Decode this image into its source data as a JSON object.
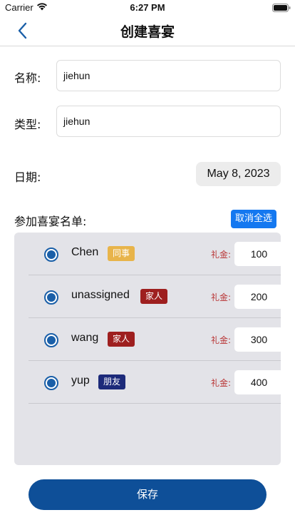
{
  "status_bar": {
    "carrier": "Carrier",
    "time": "6:27 PM"
  },
  "nav": {
    "title": "创建喜宴"
  },
  "form": {
    "name_label": "名称:",
    "name_value": "jiehun",
    "type_label": "类型:",
    "type_value": "jiehun",
    "date_label": "日期:",
    "date_value": "May 8, 2023"
  },
  "guests": {
    "section_label": "参加喜宴名单:",
    "deselect_all": "取消全选",
    "gift_label": "礼金:",
    "list": [
      {
        "name": "Chen",
        "tag": "同事",
        "tag_color": "#e8b44a",
        "gift": "100",
        "selected": true
      },
      {
        "name": "unassigned",
        "tag": "家人",
        "tag_color": "#9e1f1f",
        "gift": "200",
        "selected": true
      },
      {
        "name": "wang",
        "tag": "家人",
        "tag_color": "#9e1f1f",
        "gift": "300",
        "selected": true
      },
      {
        "name": "yup",
        "tag": "朋友",
        "tag_color": "#1c2a7a",
        "gift": "400",
        "selected": true
      }
    ]
  },
  "save_label": "保存",
  "icons": {
    "back": "chevron-left-icon",
    "wifi": "wifi-icon",
    "battery": "battery-icon"
  }
}
